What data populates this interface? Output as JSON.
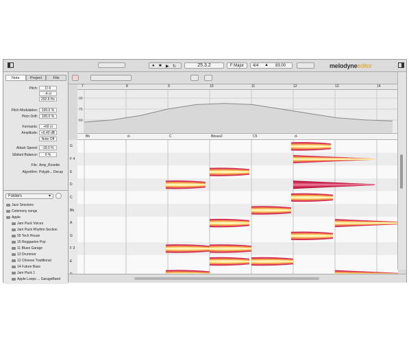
{
  "toolbar": {
    "transport_position": "25.3.2",
    "key": "F Major",
    "time_signature": "4/4",
    "tempo": "83.00",
    "logo_main": "melodyne",
    "logo_edition": "editor"
  },
  "left_panel": {
    "tabs": [
      "Note",
      "Project",
      "File"
    ],
    "active_tab": "Note",
    "pitch_label": "Pitch:",
    "pitch_note": "D 4",
    "pitch_cents": "-4 ct",
    "pitch_hz": "292.6 Hz",
    "pitch_mod_label": "Pitch Modulation:",
    "pitch_mod": "100.0 %",
    "pitch_drift_label": "Pitch Drift:",
    "pitch_drift": "100.0 %",
    "formants_label": "Formants:",
    "formants": "+60 ct",
    "amplitude_label": "Amplitude:",
    "amplitude": "+6.40 dB",
    "note_off": "Note Off",
    "attack_label": "Attack Speed:",
    "attack": "-18.0 %",
    "sibilant_label": "Sibilant Balance:",
    "sibilant": "0 %",
    "file_label": "File:",
    "file": "Amp_Rosette",
    "algorithm_label": "Algorithm:",
    "algorithm": "Polyph... Decay"
  },
  "browser": {
    "dropdown": "Folders",
    "items": [
      {
        "label": "Jazz Sessions",
        "indent": 0
      },
      {
        "label": "Celemony songs",
        "indent": 0
      },
      {
        "label": "Apple",
        "indent": 0
      },
      {
        "label": "Jam Pack Voices",
        "indent": 1
      },
      {
        "label": "Jam Pack Rhythm Section",
        "indent": 1
      },
      {
        "label": "05 Tech House",
        "indent": 1
      },
      {
        "label": "15 Reggaeton Pop",
        "indent": 1
      },
      {
        "label": "11 Blues Garage",
        "indent": 1
      },
      {
        "label": "13 Drummer",
        "indent": 1
      },
      {
        "label": "12 Chinese Traditional",
        "indent": 1
      },
      {
        "label": "14 Future Bass",
        "indent": 1
      },
      {
        "label": "Jam Pack 1",
        "indent": 1
      },
      {
        "label": "Apple Loops ... GarageBand",
        "indent": 1
      }
    ]
  },
  "ruler": {
    "bars": [
      "7",
      "8",
      "9",
      "10",
      "11",
      "12",
      "13",
      "14"
    ]
  },
  "tempo_lane": {
    "labels": [
      "90",
      "75",
      "60"
    ],
    "values": [
      60,
      62,
      66,
      72,
      76,
      77,
      76,
      72,
      68,
      64,
      62,
      61
    ]
  },
  "chords": [
    "Bb",
    "d-",
    "C",
    "Bbsus2",
    "C5",
    "d-"
  ],
  "pitch_labels": [
    "G",
    "F 4",
    "E",
    "D",
    "C",
    "Bb",
    "A",
    "G",
    "F 3",
    "E",
    "D"
  ],
  "colors": {
    "blob_outer": "#d4345a",
    "blob_mid": "#f6a04a",
    "blob_inner": "#fff3b0",
    "selected": "#b8163e"
  },
  "notes": [
    {
      "bar": 8.95,
      "len": 0.95,
      "row": 3,
      "selected": false
    },
    {
      "bar": 10.0,
      "len": 0.95,
      "row": 2,
      "selected": false
    },
    {
      "bar": 10.0,
      "len": 0.95,
      "row": 6,
      "selected": false
    },
    {
      "bar": 11.0,
      "len": 0.95,
      "row": 5,
      "selected": false
    },
    {
      "bar": 11.95,
      "len": 0.95,
      "row": 0,
      "selected": false
    },
    {
      "bar": 12.0,
      "len": 1.95,
      "row": 1,
      "selected": false
    },
    {
      "bar": 12.0,
      "len": 1.95,
      "row": 3,
      "selected": true
    },
    {
      "bar": 11.95,
      "len": 1.0,
      "row": 4,
      "selected": false
    },
    {
      "bar": 11.95,
      "len": 1.0,
      "row": 7,
      "selected": false
    },
    {
      "bar": 13.0,
      "len": 1.95,
      "row": 6,
      "selected": false
    },
    {
      "bar": 10.0,
      "len": 1.0,
      "row": 8,
      "selected": false
    },
    {
      "bar": 8.95,
      "len": 1.05,
      "row": 8,
      "selected": false
    },
    {
      "bar": 8.95,
      "len": 1.05,
      "row": 10,
      "selected": false
    },
    {
      "bar": 10.0,
      "len": 0.95,
      "row": 9,
      "selected": false
    },
    {
      "bar": 11.0,
      "len": 1.0,
      "row": 9,
      "selected": false
    },
    {
      "bar": 13.0,
      "len": 1.95,
      "row": 10,
      "selected": false
    }
  ]
}
